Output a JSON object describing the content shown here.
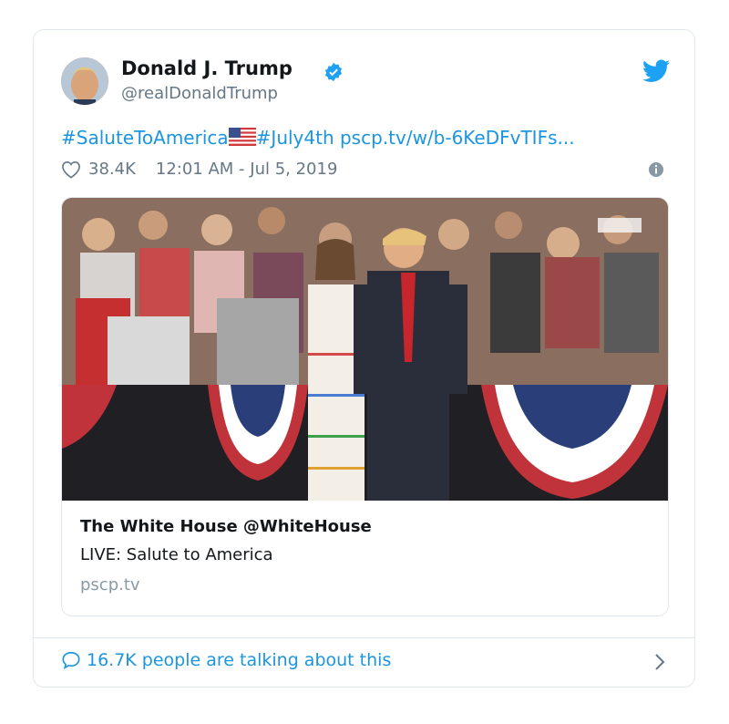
{
  "tweet": {
    "author_name": "Donald J. Trump",
    "author_handle": "@realDonaldTrump",
    "hashtag1": "#SaluteToAmerica",
    "hashtag2": "#July4th",
    "link": "pscp.tv/w/b-6KeDFvTIFs...",
    "likes": "38.4K",
    "timestamp": "12:01 AM - Jul 5, 2019"
  },
  "media_card": {
    "title": "The White House @WhiteHouse",
    "description": "LIVE: Salute to America",
    "domain": "pscp.tv"
  },
  "footer": {
    "talking_text": "16.7K people are talking about this"
  },
  "icons": {
    "verified": "verified-badge-icon",
    "bird": "twitter-bird-icon",
    "heart": "heart-icon",
    "info": "info-icon",
    "speech": "speech-bubble-icon",
    "chevron": "chevron-right-icon"
  },
  "colors": {
    "link": "#1b95e0",
    "secondary_text": "#657786",
    "border": "#e1e8ed"
  }
}
